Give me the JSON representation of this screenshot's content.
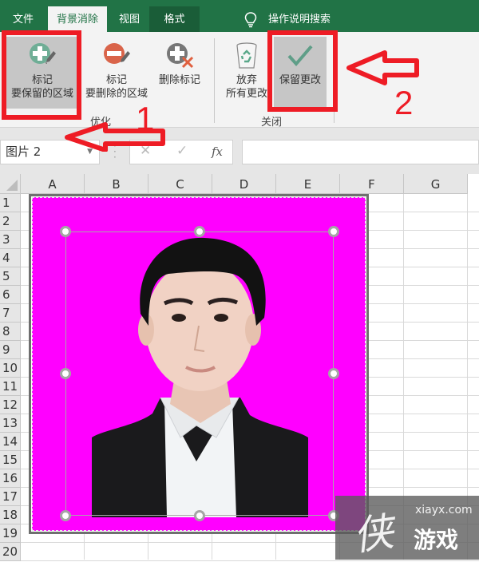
{
  "tabs": [
    {
      "label": "文件",
      "active": false
    },
    {
      "label": "背景消除",
      "active": true
    },
    {
      "label": "视图",
      "active": false
    },
    {
      "label": "格式",
      "active": false
    }
  ],
  "search": {
    "label": "操作说明搜索",
    "icon": "lightbulb-icon"
  },
  "ribbon": {
    "groups": [
      {
        "label": "优化",
        "buttons": [
          {
            "line1": "标记",
            "line2": "要保留的区域",
            "icon": "mark-keep-icon",
            "selected": true
          },
          {
            "line1": "标记",
            "line2": "要删除的区域",
            "icon": "mark-remove-icon",
            "selected": false
          },
          {
            "line1": "删除标记",
            "line2": "",
            "icon": "delete-mark-icon",
            "selected": false
          }
        ]
      },
      {
        "label": "关闭",
        "buttons": [
          {
            "line1": "放弃",
            "line2": "所有更改",
            "icon": "recycle-bin-icon",
            "selected": false
          },
          {
            "line1": "保留更改",
            "line2": "",
            "icon": "checkmark-icon",
            "selected": true
          }
        ]
      }
    ]
  },
  "formula_bar": {
    "name_box": "图片 2",
    "cancel_symbol": "✕",
    "enter_symbol": "✓",
    "fx_symbol": "fx",
    "formula_value": ""
  },
  "sheet": {
    "columns": [
      "A",
      "B",
      "C",
      "D",
      "E",
      "F",
      "G"
    ],
    "rows": [
      "1",
      "2",
      "3",
      "4",
      "5",
      "6",
      "7",
      "8",
      "9",
      "10",
      "11",
      "12",
      "13",
      "14",
      "15",
      "16",
      "17",
      "18",
      "19",
      "20"
    ]
  },
  "picture": {
    "name": "图片 2",
    "background_removed_color": "#ff00ff",
    "description": "ID photo of young man in black velvet suit and white shirt"
  },
  "annotations": {
    "step1": "1",
    "step2": "2",
    "color": "#ee1c25"
  },
  "watermark": {
    "site": "xiayx.com",
    "name": "游戏",
    "logo_char": "侠"
  },
  "colors": {
    "excel_green": "#217346",
    "ribbon_bg": "#f3f3f3",
    "selected_btn": "#c6c6c6"
  }
}
